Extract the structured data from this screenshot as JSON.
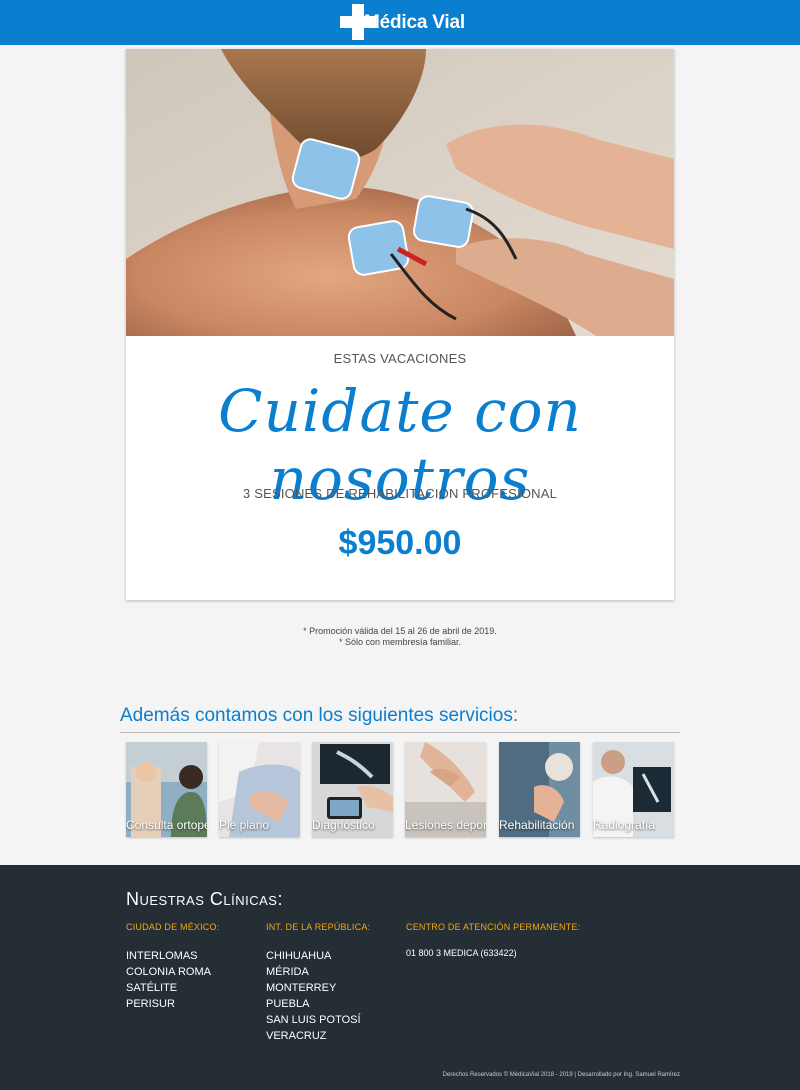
{
  "header": {
    "brand": "Médica Vial",
    "brand_color": "#0b7fcf",
    "logo_icon": "medical-cross-icon"
  },
  "promo": {
    "kicker": "ESTAS VACACIONES",
    "headline": "Cuidate con nosotros",
    "subline": "3 SESIONES DE REHABILITACIÓN PROFESIONAL",
    "price": "$950.00",
    "notes": [
      "* Promoción válida del 15 al 26 de abril de 2019.",
      "* Sólo con membresía familiar."
    ]
  },
  "services": {
    "title": "Además contamos con los siguientes servicios:",
    "items": [
      {
        "label": "Consulta ortopédica"
      },
      {
        "label": "Pie plano"
      },
      {
        "label": "Diagnóstico"
      },
      {
        "label": "Lesiones deportivas"
      },
      {
        "label": "Rehabilitación"
      },
      {
        "label": "Radiografía"
      }
    ]
  },
  "footer": {
    "title": "Nuestras Clínicas:",
    "accent_color": "#f3a712",
    "columns": [
      {
        "heading": "CIUDAD DE MÉXICO:",
        "items": [
          "INTERLOMAS",
          "COLONIA ROMA",
          "SATÉLITE",
          "PERISUR"
        ]
      },
      {
        "heading": "INT. DE LA REPÚBLICA:",
        "items": [
          "CHIHUAHUA",
          "MÉRIDA",
          "MONTERREY",
          "PUEBLA",
          "SAN LUIS POTOSÍ",
          "VERACRUZ"
        ]
      },
      {
        "heading": "CENTRO DE ATENCIÓN PERMANENTE:",
        "items": [
          "01 800 3 MEDICA (633422)"
        ]
      }
    ],
    "copyright": "Derechos Reservados © MédicaVial 2018 - 2019 | Desarrollado por Ing. Samuel Ramírez"
  }
}
